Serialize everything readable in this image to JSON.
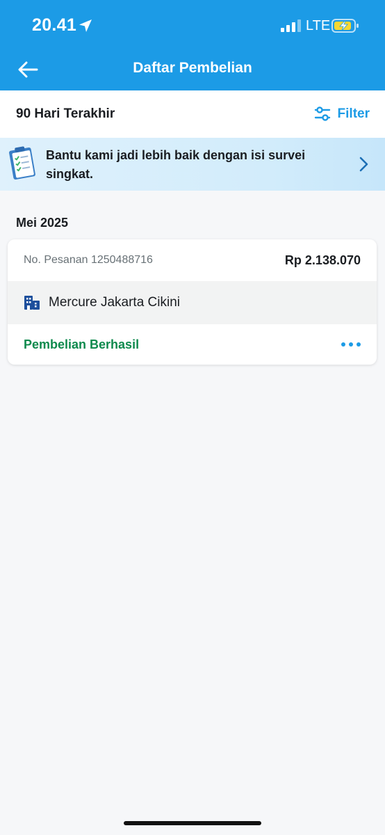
{
  "status_bar": {
    "time": "20.41",
    "network": "LTE"
  },
  "header": {
    "title": "Daftar Pembelian"
  },
  "filter_bar": {
    "period": "90 Hari Terakhir",
    "filter_label": "Filter"
  },
  "survey": {
    "text": "Bantu kami jadi lebih baik dengan isi survei singkat."
  },
  "section": {
    "title": "Mei 2025"
  },
  "order": {
    "number": "No. Pesanan 1250488716",
    "price": "Rp 2.138.070",
    "hotel": "Mercure Jakarta Cikini",
    "status": "Pembelian Berhasil"
  },
  "colors": {
    "primary": "#1c9be6",
    "success": "#0e8a4d",
    "text": "#1a1d21",
    "muted": "#687176"
  },
  "icons": {
    "location": "location-arrow-icon",
    "signal": "signal-icon",
    "battery": "battery-charging-icon",
    "back": "arrow-left-icon",
    "filter": "sliders-icon",
    "survey": "clipboard-checklist-icon",
    "chevron": "chevron-right-icon",
    "hotel": "building-icon",
    "more": "more-dots-icon"
  }
}
